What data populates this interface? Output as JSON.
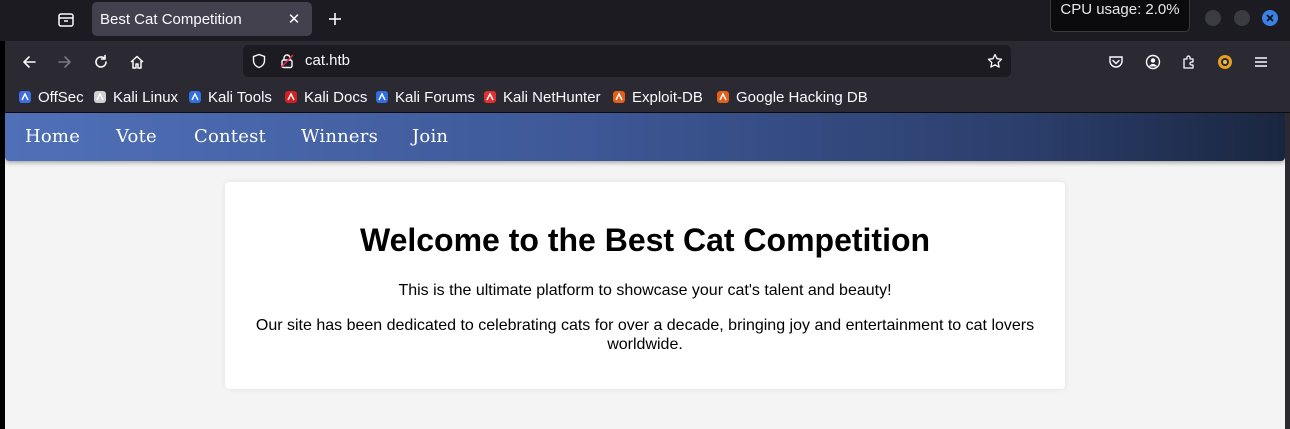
{
  "browser": {
    "tab": {
      "title": "Best Cat Competition",
      "close_glyph": "✕"
    },
    "new_tab_glyph": "+",
    "cpu_usage": "CPU usage: 2.0%",
    "url": "cat.htb",
    "bookmarks": [
      {
        "label": "OffSec",
        "icon": "offsec-icon",
        "color": "#3d6ee0"
      },
      {
        "label": "Kali Linux",
        "icon": "kali-dragon-icon",
        "color": "#d0d0d0"
      },
      {
        "label": "Kali Tools",
        "icon": "kali-tools-icon",
        "color": "#2f6fe0"
      },
      {
        "label": "Kali Docs",
        "icon": "kali-docs-icon",
        "color": "#d42020"
      },
      {
        "label": "Kali Forums",
        "icon": "kali-forums-icon",
        "color": "#2f6fe0"
      },
      {
        "label": "Kali NetHunter",
        "icon": "nethunter-icon",
        "color": "#e03030"
      },
      {
        "label": "Exploit-DB",
        "icon": "exploitdb-icon",
        "color": "#e0601c"
      },
      {
        "label": "Google Hacking DB",
        "icon": "ghdb-icon",
        "color": "#e0601c"
      }
    ]
  },
  "site": {
    "nav": [
      "Home",
      "Vote",
      "Contest",
      "Winners",
      "Join"
    ],
    "heading": "Welcome to the Best Cat Competition",
    "paragraphs": [
      "This is the ultimate platform to showcase your cat's talent and beauty!",
      "Our site has been dedicated to celebrating cats for over a decade, bringing joy and entertainment to cat lovers worldwide."
    ]
  },
  "colors": {
    "accent_close": "#3b82e6",
    "nav_gradient_start": "#4f70b8",
    "nav_gradient_end": "#1a2640"
  }
}
